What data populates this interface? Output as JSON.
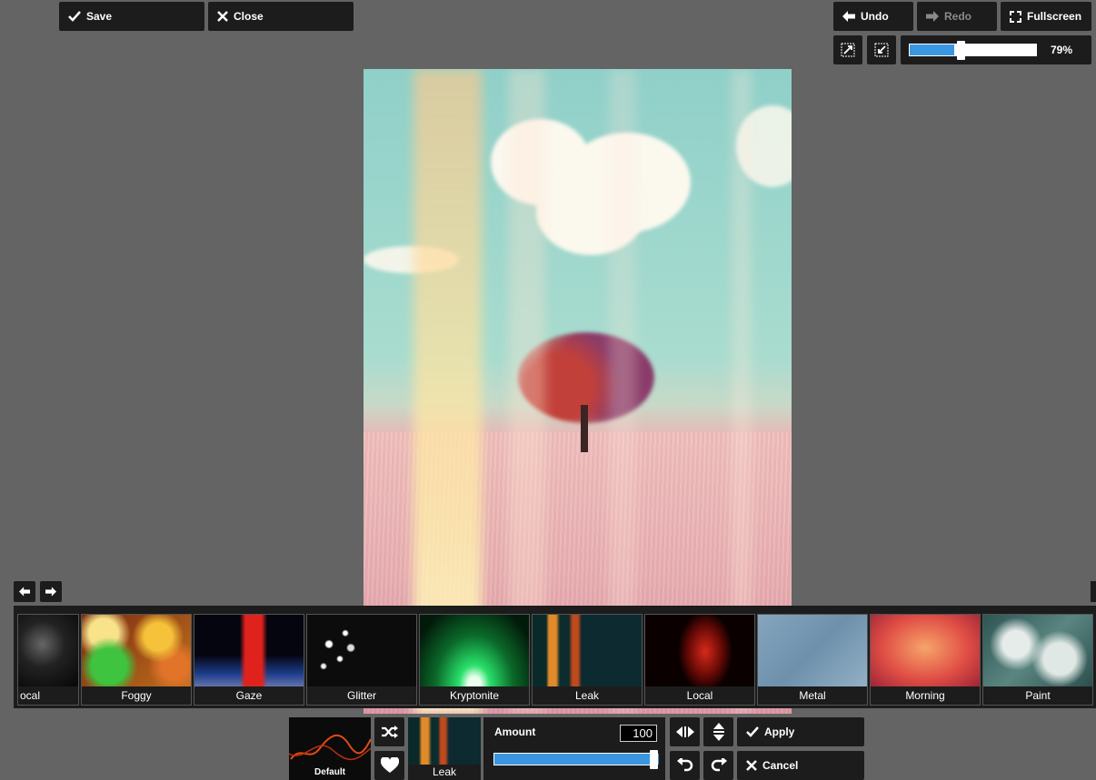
{
  "toolbar": {
    "save_label": "Save",
    "close_label": "Close",
    "undo_label": "Undo",
    "redo_label": "Redo",
    "fullscreen_label": "Fullscreen"
  },
  "zoom": {
    "value": 0.79,
    "label": "79%"
  },
  "filters": {
    "items": [
      {
        "label": "ocal"
      },
      {
        "label": "Foggy"
      },
      {
        "label": "Gaze"
      },
      {
        "label": "Glitter"
      },
      {
        "label": "Kryptonite"
      },
      {
        "label": "Leak"
      },
      {
        "label": "Local"
      },
      {
        "label": "Metal"
      },
      {
        "label": "Morning"
      },
      {
        "label": "Paint"
      }
    ]
  },
  "overlay": {
    "default_label": "Default",
    "selected_label": "Leak",
    "amount_label": "Amount",
    "amount_value": "100",
    "amount_fraction": 1.0,
    "apply_label": "Apply",
    "cancel_label": "Cancel"
  },
  "colors": {
    "background": "#646464",
    "panel": "#1c1c1c",
    "accent": "#3a96e0"
  }
}
